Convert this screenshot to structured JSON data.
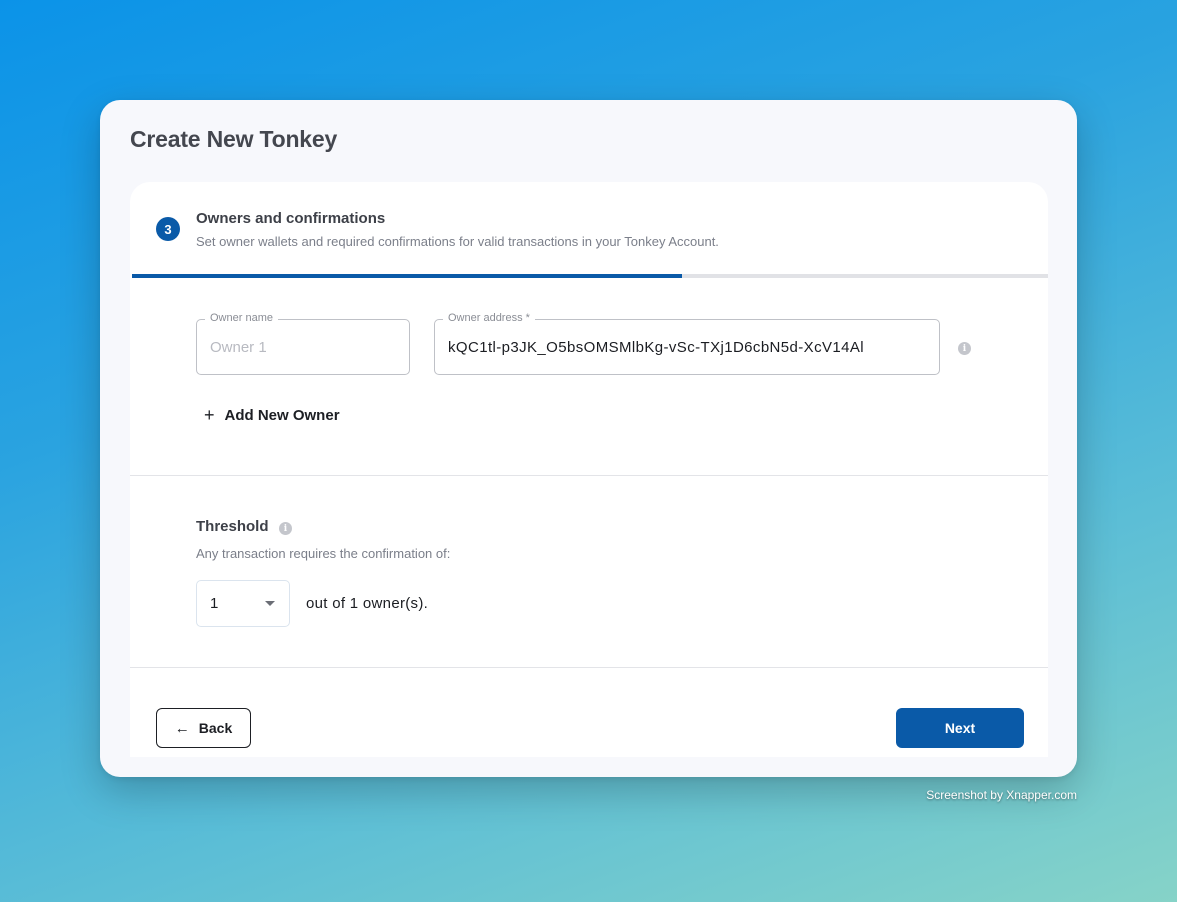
{
  "page": {
    "title": "Create New Tonkey"
  },
  "step": {
    "number": "3",
    "title": "Owners and confirmations",
    "description": "Set owner wallets and required confirmations for valid transactions in your Tonkey Account.",
    "progress_fraction": 0.6
  },
  "owner": {
    "name_label": "Owner name",
    "name_placeholder": "Owner 1",
    "address_label": "Owner address *",
    "address_value": "kQC1tl-p3JK_O5bsOMSMlbKg-vSc-TXj1D6cbN5d-XcV14Al",
    "info_icon": "i"
  },
  "add_owner": {
    "icon": "+",
    "label": "Add New Owner"
  },
  "threshold": {
    "title": "Threshold",
    "info_icon": "i",
    "description": "Any transaction requires the confirmation of:",
    "selected": "1",
    "suffix": "out of 1 owner(s)."
  },
  "buttons": {
    "back_icon": "←",
    "back": "Back",
    "next": "Next"
  },
  "watermark": "Screenshot by Xnapper.com",
  "colors": {
    "accent": "#0a5aa8",
    "background_start": "#0b93e8",
    "background_end": "#86d3c8"
  }
}
